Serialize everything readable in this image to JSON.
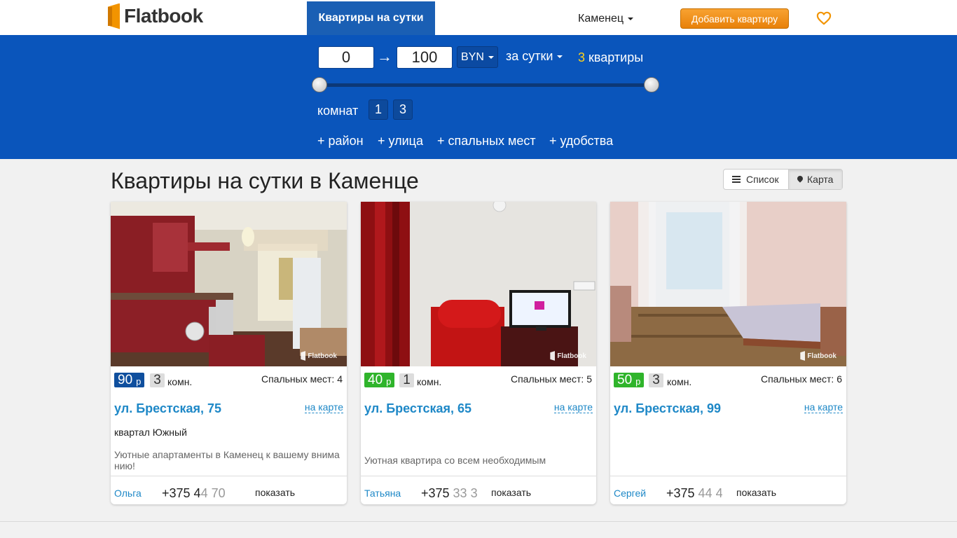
{
  "header": {
    "logo_text": "Flatbook",
    "nav_tab": "Квартиры на сутки",
    "city": "Каменец",
    "add_button": "Добавить квартиру",
    "favorites_icon": "heart-icon",
    "brand_color": "#f29400",
    "accent_blue": "#0a55bb"
  },
  "filters": {
    "price_from": "0",
    "arrow": "→",
    "price_to": "100",
    "currency": "BYN",
    "period": "за сутки",
    "result_count": "3",
    "result_label": "квартиры",
    "rooms_label": "комнат",
    "rooms_options": [
      "1",
      "3"
    ],
    "extra": [
      "+ район",
      "+ улица",
      "+ спальных мест",
      "+ удобства"
    ]
  },
  "main": {
    "title": "Квартиры на сутки в Каменце",
    "view_list": "Список",
    "view_map": "Карта"
  },
  "listings": [
    {
      "price": "90",
      "price_unit": "р",
      "price_color": "#0f4f9e",
      "rooms": "3",
      "rooms_unit": "комн.",
      "beds": "Спальных мест: 4",
      "address": "ул. Брестская, 75",
      "map_link": "на карте",
      "district": "квартал Южный",
      "description": "Уютные апартаменты в Каменец к вашему внима нию!",
      "owner": "Ольга",
      "phone_visible": "+375 4",
      "phone_faded": "4 70",
      "show_label": "показать",
      "watermark": "Flatbook"
    },
    {
      "price": "40",
      "price_unit": "р",
      "price_color": "#2fb42b",
      "rooms": "1",
      "rooms_unit": "комн.",
      "beds": "Спальных мест: 5",
      "address": "ул. Брестская, 65",
      "map_link": "на карте",
      "district": "",
      "description": "Уютная квартира со всем необходимым",
      "owner": "Татьяна",
      "phone_visible": "+375 ",
      "phone_faded": "33 3",
      "show_label": "показать",
      "watermark": "Flatbook"
    },
    {
      "price": "50",
      "price_unit": "р",
      "price_color": "#2fb42b",
      "rooms": "3",
      "rooms_unit": "комн.",
      "beds": "Спальных мест: 6",
      "address": "ул. Брестская, 99",
      "map_link": "на карте",
      "district": "",
      "description": "",
      "owner": "Сергей",
      "phone_visible": "+375 ",
      "phone_faded": "44 4",
      "show_label": "показать",
      "watermark": "Flatbook"
    }
  ]
}
